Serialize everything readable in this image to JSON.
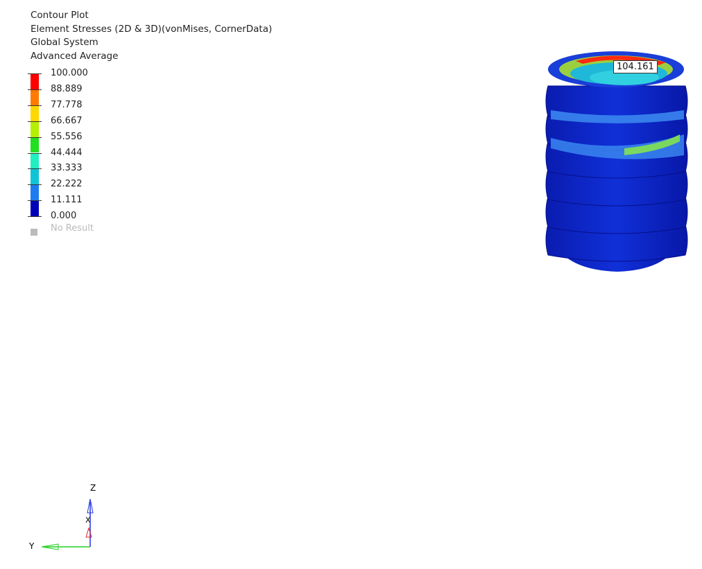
{
  "header": {
    "lines": [
      "Contour Plot",
      "Element Stresses (2D & 3D)(vonMises, CornerData)",
      "Global System",
      "Advanced Average"
    ]
  },
  "legend": {
    "labels": [
      "100.000",
      "88.889",
      "77.778",
      "66.667",
      "55.556",
      "44.444",
      "33.333",
      "22.222",
      "11.111",
      "0.000"
    ],
    "band_colors": [
      "#ff0000",
      "#ff7a00",
      "#ffd800",
      "#b4f000",
      "#20e020",
      "#20f0c0",
      "#10c4d8",
      "#1e7cf0",
      "#0000b8"
    ],
    "no_result": "No Result",
    "no_result_color": "#bbbbbb"
  },
  "probe": {
    "value": "104.161"
  },
  "triad": {
    "z": "Z",
    "y": "Y",
    "x": "X"
  }
}
